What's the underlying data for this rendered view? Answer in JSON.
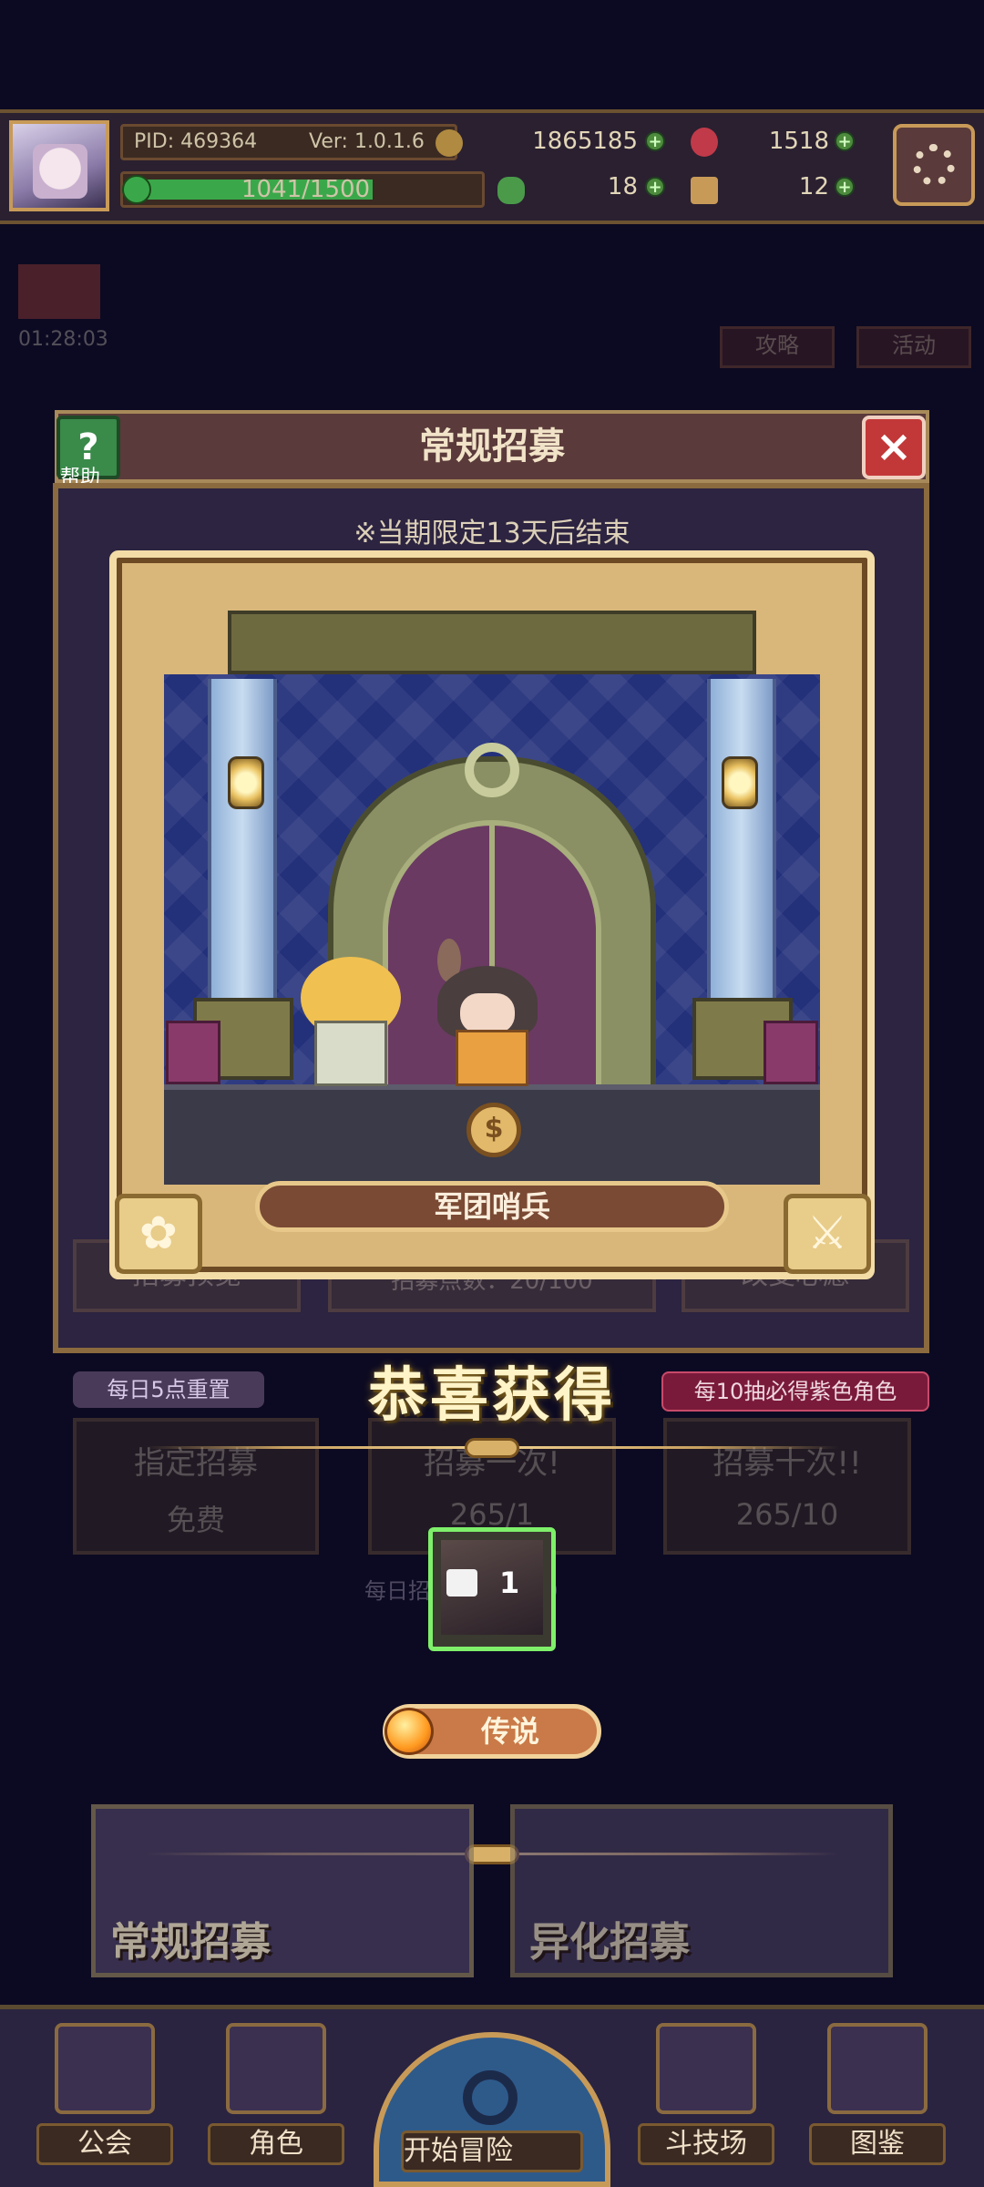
{
  "status": {
    "pid": "PID: 469364",
    "version": "Ver: 1.0.1.6",
    "exp": "1041/1500",
    "exp_fraction": 0.694,
    "coins": "1865185",
    "gems": "1518",
    "clover": "18",
    "keys": "12"
  },
  "background": {
    "timer": "01:28:03",
    "guide_btn": "攻略",
    "activity_btn": "活动"
  },
  "recruit_panel": {
    "title": "常规招募",
    "help_label": "帮助",
    "limit_notice": "※当期限定13天后结束",
    "preview_btn": "招募预览",
    "points": "招募点数：20/100",
    "wish_btn": "改变心愿",
    "reset_tag": "每日5点重置",
    "guarantee_tag": "每10抽必得紫色角色",
    "assigned_title": "指定招募",
    "assigned_cost": "免费",
    "once_title": "招募一次!",
    "once_cost": "265/1",
    "ten_title": "招募十次!!",
    "ten_cost": "265/10",
    "daily_limit": "每日招募次数 9999"
  },
  "result": {
    "character_name": "军团哨兵",
    "congrats": "恭喜获得",
    "item_count": "1",
    "rarity": "传说"
  },
  "banners": {
    "normal": "常规招募",
    "variant": "异化招募"
  },
  "nav": {
    "guild": "公会",
    "character": "角色",
    "adventure": "开始冒险",
    "arena": "斗技场",
    "codex": "图鉴"
  },
  "colors": {
    "background": "#0c0a22",
    "card_gold": "#d9b77a",
    "rarity_orange": "#c97a48",
    "slot_green": "#7ef06a"
  }
}
